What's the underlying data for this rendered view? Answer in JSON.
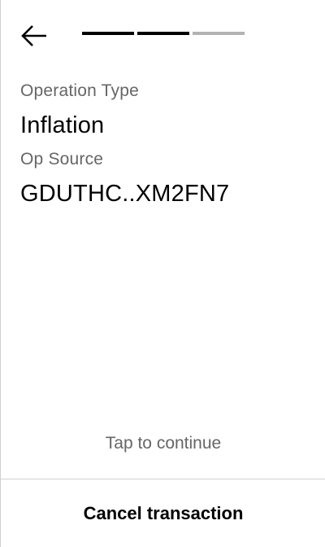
{
  "header": {
    "back_icon": "arrow-left-icon",
    "progress": {
      "total_steps": 3,
      "completed_steps": 2,
      "active_color": "#000000",
      "inactive_color": "#b3b3b3"
    }
  },
  "details": {
    "operation_type_label": "Operation Type",
    "operation_type_value": "Inflation",
    "op_source_label": "Op Source",
    "op_source_value": "GDUTHC..XM2FN7"
  },
  "footer": {
    "tap_hint": "Tap to continue",
    "cancel_label": "Cancel transaction"
  }
}
